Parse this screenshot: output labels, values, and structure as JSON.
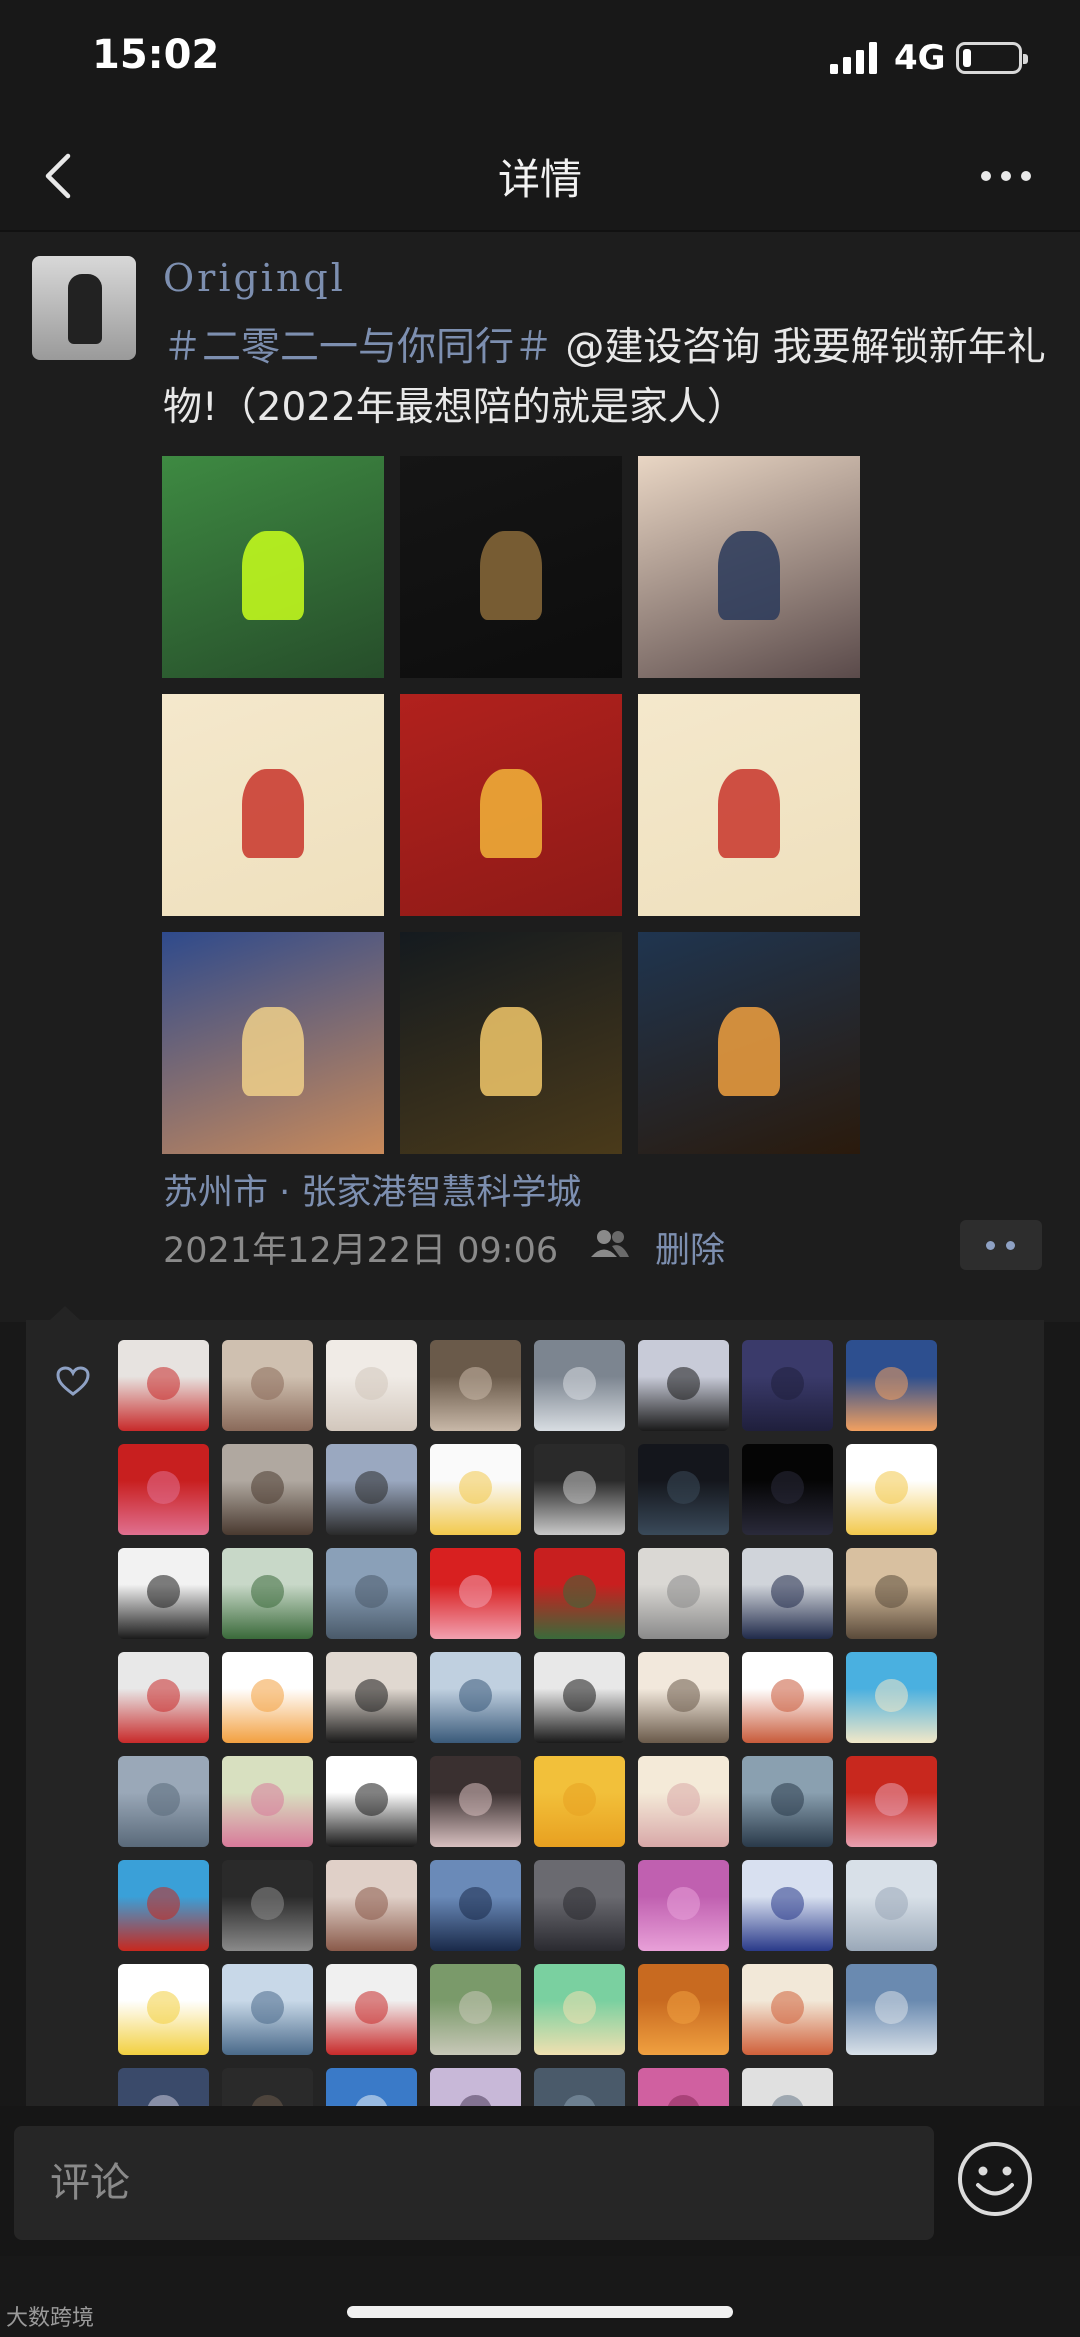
{
  "status_bar": {
    "time": "15:02",
    "network": "4G",
    "battery_level": 0.15
  },
  "nav": {
    "title": "详情"
  },
  "post": {
    "username": "Originql",
    "text_tag": "＃二零二一与你同行＃",
    "text_body": " @建设咨询 我要解锁新年礼物!（2022年最想陪的就是家人）",
    "photos": [
      {
        "name": "photo-worker",
        "colors": [
          "#3e8a42",
          "#264d2a"
        ],
        "accent": "#c8ff1c"
      },
      {
        "name": "photo-screenshot",
        "colors": [
          "#151515",
          "#0d0d0d"
        ],
        "accent": "#8a6a3a"
      },
      {
        "name": "photo-couple",
        "colors": [
          "#e9d6c4",
          "#5a4a4a"
        ],
        "accent": "#2a3a5a"
      },
      {
        "name": "photo-mascot-left",
        "colors": [
          "#f4e8cc",
          "#efe0bd"
        ],
        "accent": "#c8352a"
      },
      {
        "name": "photo-gift",
        "colors": [
          "#b1211d",
          "#8e1a17"
        ],
        "accent": "#f2b43a"
      },
      {
        "name": "photo-mascot-right",
        "colors": [
          "#f4e8cc",
          "#efe0bd"
        ],
        "accent": "#c8352a"
      },
      {
        "name": "photo-skyline",
        "colors": [
          "#2e4a8c",
          "#c98a5a"
        ],
        "accent": "#f0d08a"
      },
      {
        "name": "photo-castle",
        "colors": [
          "#141a1f",
          "#4a3a1a"
        ],
        "accent": "#f2c86a"
      },
      {
        "name": "photo-night-lake",
        "colors": [
          "#1f3550",
          "#2a1a0c"
        ],
        "accent": "#f0a040"
      }
    ],
    "location": "苏州市 · 张家港智慧科学城",
    "time": "2021年12月22日 09:06",
    "delete_label": "删除"
  },
  "likes": {
    "avatars": [
      {
        "colors": [
          "#e7e3e0",
          "#c82a2a"
        ]
      },
      {
        "colors": [
          "#cfc0b0",
          "#8a6a5a"
        ]
      },
      {
        "colors": [
          "#f0ebe6",
          "#d2c7bc"
        ]
      },
      {
        "colors": [
          "#6a5a4a",
          "#c8b8a8"
        ]
      },
      {
        "colors": [
          "#7c8590",
          "#d8dde2"
        ]
      },
      {
        "colors": [
          "#c8cbd8",
          "#1a1a1a"
        ]
      },
      {
        "colors": [
          "#3a3a6a",
          "#1f1f3c"
        ]
      },
      {
        "colors": [
          "#2d4f8f",
          "#f2a060"
        ]
      },
      {
        "colors": [
          "#c81f1f",
          "#e07090"
        ]
      },
      {
        "colors": [
          "#b0a8a0",
          "#4a3a30"
        ]
      },
      {
        "colors": [
          "#9aa8c0",
          "#2a2a2a"
        ]
      },
      {
        "colors": [
          "#fafafa",
          "#f2c94c"
        ]
      },
      {
        "colors": [
          "#2a2a2a",
          "#c9c9c9"
        ]
      },
      {
        "colors": [
          "#14161c",
          "#3a4a5a"
        ]
      },
      {
        "colors": [
          "#050505",
          "#2a2a3a"
        ]
      },
      {
        "colors": [
          "#ffffff",
          "#f2c94c"
        ]
      },
      {
        "colors": [
          "#f2f2f2",
          "#1a1a1a"
        ]
      },
      {
        "colors": [
          "#c8d8c8",
          "#3a6a3a"
        ]
      },
      {
        "colors": [
          "#8aa0b8",
          "#4a5a6a"
        ]
      },
      {
        "colors": [
          "#d82020",
          "#f2a0b0"
        ]
      },
      {
        "colors": [
          "#c81f1f",
          "#3a6a3a"
        ]
      },
      {
        "colors": [
          "#dad8d4",
          "#8a8a8a"
        ]
      },
      {
        "colors": [
          "#d0d4da",
          "#202a4a"
        ]
      },
      {
        "colors": [
          "#d8c0a0",
          "#5a4a3a"
        ]
      },
      {
        "colors": [
          "#e8e8e8",
          "#c82a2a"
        ]
      },
      {
        "colors": [
          "#ffffff",
          "#f2a040"
        ]
      },
      {
        "colors": [
          "#e0d8d0",
          "#1a1a1a"
        ]
      },
      {
        "colors": [
          "#c0d0e0",
          "#3a5a7a"
        ]
      },
      {
        "colors": [
          "#e8e8e8",
          "#1a1a1a"
        ]
      },
      {
        "colors": [
          "#f2e8dc",
          "#6a5a4a"
        ]
      },
      {
        "colors": [
          "#ffffff",
          "#c85a3a"
        ]
      },
      {
        "colors": [
          "#4ab0e0",
          "#f2e8c8"
        ]
      },
      {
        "colors": [
          "#9aa8b8",
          "#5a6a7a"
        ]
      },
      {
        "colors": [
          "#d8e0c0",
          "#d87a9a"
        ]
      },
      {
        "colors": [
          "#ffffff",
          "#1a1a1a"
        ]
      },
      {
        "colors": [
          "#3a3030",
          "#d8c0c0"
        ]
      },
      {
        "colors": [
          "#f2c03a",
          "#e8a020"
        ]
      },
      {
        "colors": [
          "#f4ead8",
          "#d8a8a8"
        ]
      },
      {
        "colors": [
          "#8aa0b0",
          "#2a3a4a"
        ]
      },
      {
        "colors": [
          "#c8281e",
          "#e8a0b0"
        ]
      },
      {
        "colors": [
          "#3aa0d8",
          "#c8281e"
        ]
      },
      {
        "colors": [
          "#2a2a2a",
          "#8a8a8a"
        ]
      },
      {
        "colors": [
          "#e0d0c8",
          "#8a5a4a"
        ]
      },
      {
        "colors": [
          "#6a8ab8",
          "#1a2a4a"
        ]
      },
      {
        "colors": [
          "#6a6a70",
          "#2a2a30"
        ]
      },
      {
        "colors": [
          "#c060b0",
          "#e8a0d8"
        ]
      },
      {
        "colors": [
          "#d8e0f0",
          "#2a3a8a"
        ]
      },
      {
        "colors": [
          "#d8e0e8",
          "#9aa8b8"
        ]
      },
      {
        "colors": [
          "#ffffff",
          "#f2d040"
        ]
      },
      {
        "colors": [
          "#c8d8e8",
          "#4a6a8a"
        ]
      },
      {
        "colors": [
          "#f0f0f0",
          "#c82a2a"
        ]
      },
      {
        "colors": [
          "#7a9a6a",
          "#c8c8b8"
        ]
      },
      {
        "colors": [
          "#7ad0a0",
          "#f0e0b0"
        ]
      },
      {
        "colors": [
          "#c86a20",
          "#f0a040"
        ]
      },
      {
        "colors": [
          "#f2e8d8",
          "#d0603a"
        ]
      },
      {
        "colors": [
          "#6a8ab0",
          "#d8e0e8"
        ]
      },
      {
        "colors": [
          "#3a4a6a",
          "#c8c8d8"
        ]
      },
      {
        "colors": [
          "#2a2a2a",
          "#6a5a4a"
        ]
      },
      {
        "colors": [
          "#3a7ac8",
          "#e8f0f8"
        ]
      },
      {
        "colors": [
          "#c8b8d8",
          "#4a3a5a"
        ]
      },
      {
        "colors": [
          "#4a5a6a",
          "#8aa0b0"
        ]
      },
      {
        "colors": [
          "#d060a0",
          "#8a2a5a"
        ]
      },
      {
        "colors": [
          "#e0e0e0",
          "#6a7a8a"
        ]
      }
    ]
  },
  "comment": {
    "placeholder": "评论"
  },
  "watermark": "大数跨境"
}
